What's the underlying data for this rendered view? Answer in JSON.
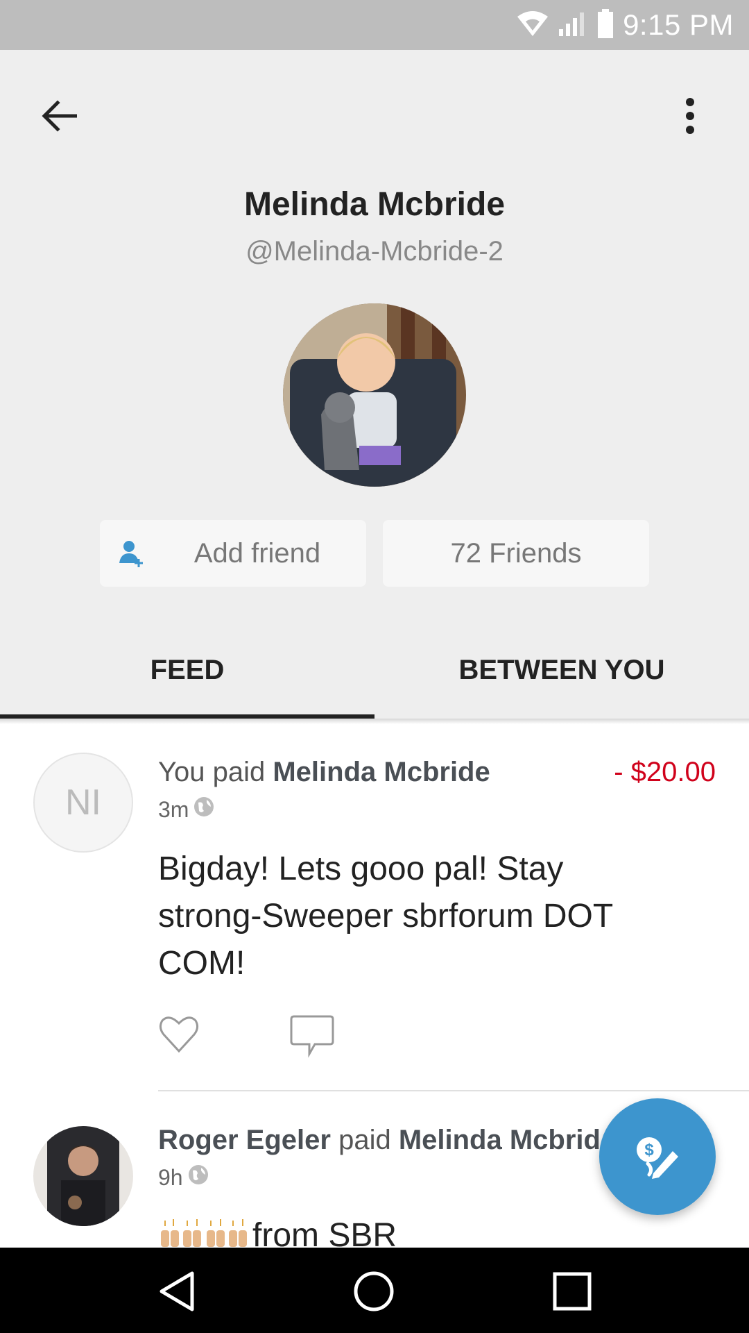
{
  "status_bar": {
    "time": "9:15 PM"
  },
  "header": {
    "name": "Melinda Mcbride",
    "handle": "@Melinda-Mcbride-2",
    "add_friend_label": "Add friend",
    "friends_label": "72 Friends"
  },
  "tabs": [
    {
      "label": "FEED",
      "selected": true
    },
    {
      "label": "BETWEEN YOU",
      "selected": false
    }
  ],
  "feed": [
    {
      "avatar_initials": "NI",
      "headline_prefix": "You paid ",
      "headline_target": "Melinda Mcbride",
      "amount": "- $20.00",
      "time": "3m",
      "message": "Bigday!  Lets gooo pal!  Stay strong-Sweeper sbrforum DOT COM!"
    },
    {
      "actor": "Roger Egeler",
      "verb": " paid ",
      "target": "Melinda Mcbrid",
      "time": "9h",
      "message": "from SBR"
    }
  ],
  "colors": {
    "accent": "#3d95ce",
    "negative_amount": "#d0021b",
    "header_bg": "#eeeeee"
  },
  "icons": [
    "back-arrow-icon",
    "more-vert-icon",
    "add-person-icon",
    "globe-icon",
    "heart-icon",
    "comment-icon",
    "pay-request-icon"
  ]
}
